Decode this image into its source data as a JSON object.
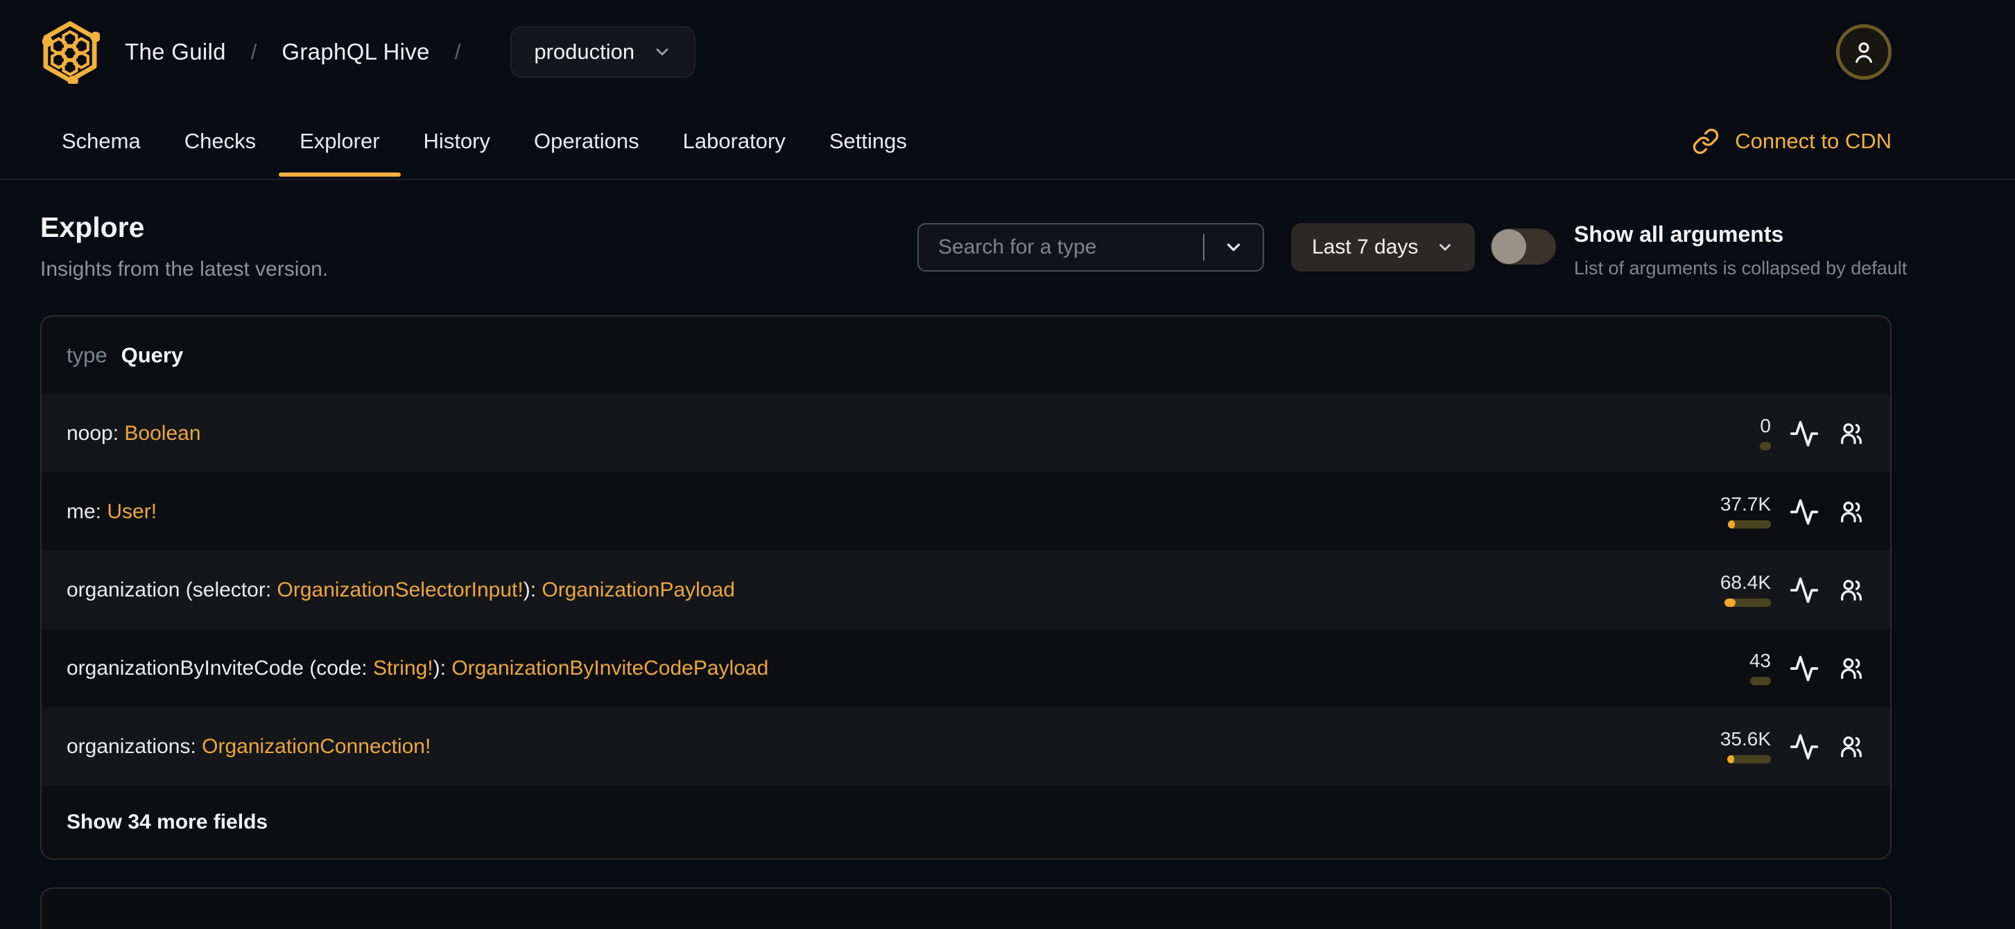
{
  "colors": {
    "accent": "#f2b13d",
    "type_link": "#eca63e",
    "bar_track": "#4a431f",
    "bar_fill": "#f0a92c"
  },
  "topbar": {
    "logo_icon": "hive-logo-icon",
    "breadcrumb": {
      "org": "The Guild",
      "separator": "/",
      "project": "GraphQL Hive",
      "target_selector": {
        "value": "production",
        "icon": "chevron-down-icon"
      }
    },
    "avatar_icon": "user-icon"
  },
  "tabs": [
    {
      "label": "Schema",
      "active": false
    },
    {
      "label": "Checks",
      "active": false
    },
    {
      "label": "Explorer",
      "active": true
    },
    {
      "label": "History",
      "active": false
    },
    {
      "label": "Operations",
      "active": false
    },
    {
      "label": "Laboratory",
      "active": false
    },
    {
      "label": "Settings",
      "active": false
    }
  ],
  "cdn_link": {
    "label": "Connect to CDN",
    "icon": "link-icon"
  },
  "page": {
    "title": "Explore",
    "subtitle": "Insights from the latest version."
  },
  "controls": {
    "type_search": {
      "placeholder": "Search for a type",
      "icon": "chevron-down-icon"
    },
    "period_select": {
      "value": "Last 7 days",
      "icon": "chevron-down-icon"
    },
    "arguments_toggle": {
      "state": "off",
      "label": "Show all arguments",
      "description": "List of arguments is collapsed by default"
    }
  },
  "type_card": {
    "kind": "type",
    "name": "Query",
    "row_icons": [
      "activity-icon",
      "users-icon"
    ],
    "fields": [
      {
        "name": "noop",
        "segments": [
          {
            "text": "noop: ",
            "style": "plain"
          },
          {
            "text": "Boolean",
            "style": "type"
          }
        ],
        "count": "0",
        "bar": {
          "track": 16,
          "fill": 0
        }
      },
      {
        "name": "me",
        "segments": [
          {
            "text": "me: ",
            "style": "plain"
          },
          {
            "text": "User!",
            "style": "type"
          }
        ],
        "count": "37.7K",
        "bar": {
          "track": 62,
          "fill": 10
        }
      },
      {
        "name": "organization",
        "segments": [
          {
            "text": "organization (selector: ",
            "style": "plain"
          },
          {
            "text": "OrganizationSelectorInput!",
            "style": "type"
          },
          {
            "text": "): ",
            "style": "plain"
          },
          {
            "text": "OrganizationPayload",
            "style": "type"
          }
        ],
        "count": "68.4K",
        "bar": {
          "track": 67,
          "fill": 16
        }
      },
      {
        "name": "organizationByInviteCode",
        "segments": [
          {
            "text": "organizationByInviteCode (code: ",
            "style": "plain"
          },
          {
            "text": "String!",
            "style": "type"
          },
          {
            "text": "): ",
            "style": "plain"
          },
          {
            "text": "OrganizationByInviteCodePayload",
            "style": "type"
          }
        ],
        "count": "43",
        "bar": {
          "track": 30,
          "fill": 0
        }
      },
      {
        "name": "organizations",
        "segments": [
          {
            "text": "organizations: ",
            "style": "plain"
          },
          {
            "text": "OrganizationConnection!",
            "style": "type"
          }
        ],
        "count": "35.6K",
        "bar": {
          "track": 63,
          "fill": 10
        }
      }
    ],
    "footer": "Show 34 more fields"
  }
}
